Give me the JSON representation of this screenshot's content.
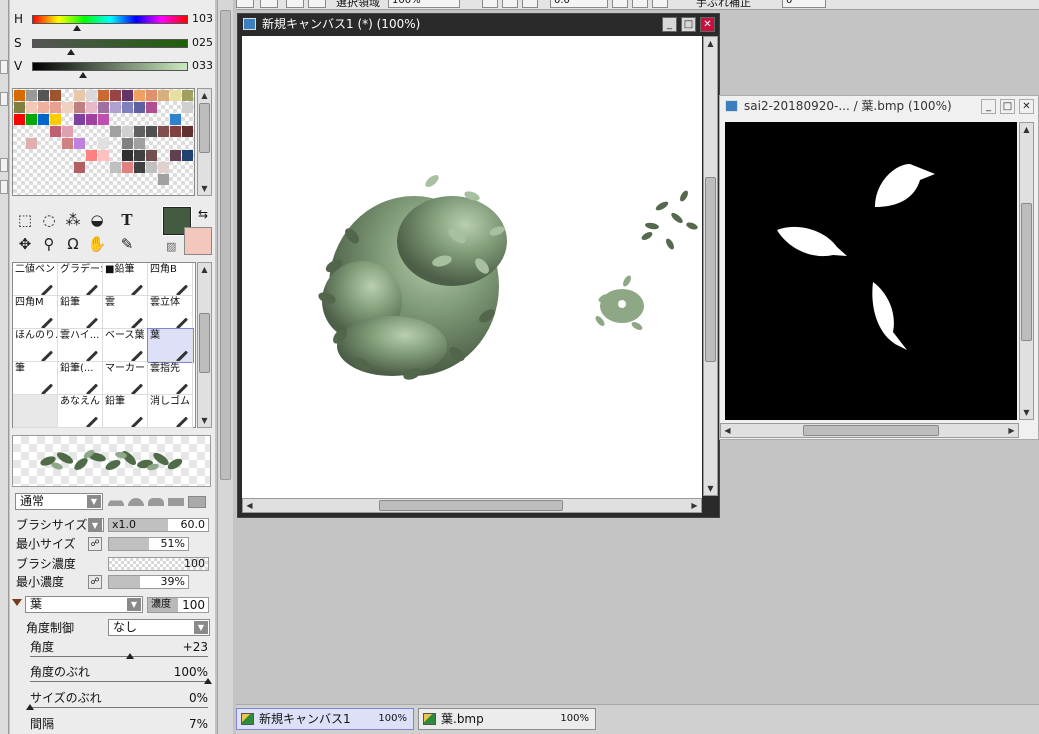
{
  "toolbar": {
    "select_area_label": "選択領域",
    "zoom_value": "100%",
    "angle_value": "0.0",
    "stabilizer_label": "手ぶれ補正",
    "stabilizer_value": "0"
  },
  "color": {
    "h_label": "H",
    "h_value": "103",
    "h_level": 0.29,
    "s_label": "S",
    "s_value": "025",
    "s_level": 0.25,
    "v_label": "V",
    "v_value": "033",
    "v_level": 0.33,
    "foreground": "#435b40",
    "background": "#f4c7bd"
  },
  "swatches": [
    "#d96a00",
    "#999999",
    "#555555",
    "#a0522d",
    "#ffffff",
    "#e8c8a8",
    "#d9d9d9",
    "#cc6633",
    "#994444",
    "#663366",
    "#f0a060",
    "#e0906a",
    "#d8b080",
    "#e8e0a0",
    "#a0a060",
    "#808040",
    "#f4c8b8",
    "#f0b0a0",
    "#e8a090",
    "#f0d0c0",
    "#c08080",
    "#e8b8c8",
    "#a070a0",
    "#b0a0d0",
    "#8080c0",
    "#6060a0",
    "#b05090",
    "#ffffff",
    "#ffffff",
    "#d0d0d0",
    "#ff0000",
    "#00aa00",
    "#0066cc",
    "#ffcc00",
    "#ffffff",
    "#8040a0",
    "#a040a0",
    "#c050b0",
    "#ffffff",
    "#ffffff",
    "#ffffff",
    "#ffffff",
    "#ffffff",
    "#3080d0",
    "#ffffff",
    "#ffffff",
    "#ffffff",
    "#ffffff",
    "#c06070",
    "#e0a0b0",
    "#ffffff",
    "#ffffff",
    "#ffffff",
    "#a0a0a0",
    "#d0d0d0",
    "#606060",
    "#505050",
    "#805050",
    "#804040",
    "#603030",
    "#ffffff",
    "#e0b0b0",
    "#ffffff",
    "#ffffff",
    "#d08080",
    "#c080e0",
    "#ffffff",
    "#e0e0e0",
    "#ffffff",
    "#808080",
    "#a0a0a0",
    "#ffffff",
    "#ffffff",
    "#ffffff",
    "#ffffff",
    "#ffffff",
    "#ffffff",
    "#ffffff",
    "#ffffff",
    "#ffffff",
    "#ffffff",
    "#ff8080",
    "#ffc0c0",
    "#ffffff",
    "#303030",
    "#404040",
    "#705050",
    "#ffffff",
    "#604050",
    "#204070",
    "#ffffff",
    "#ffffff",
    "#ffffff",
    "#ffffff",
    "#ffffff",
    "#b06060",
    "#ffffff",
    "#ffffff",
    "#c0c0c0",
    "#e08080",
    "#404040",
    "#c0c0c0",
    "#e0d0d0",
    "#ffffff",
    "#ffffff",
    "#ffffff",
    "#ffffff",
    "#ffffff",
    "#ffffff",
    "#ffffff",
    "#ffffff",
    "#ffffff",
    "#ffffff",
    "#ffffff",
    "#ffffff",
    "#ffffff",
    "#ffffff",
    "#a0a0a0",
    "#ffffff",
    "#ffffff",
    "#ffffff",
    "#ffffff",
    "#ffffff",
    "#ffffff",
    "#ffffff",
    "#ffffff",
    "#ffffff",
    "#ffffff"
  ],
  "brushes": [
    {
      "label": "二値ペン",
      "selected": false
    },
    {
      "label": "グラデーション",
      "selected": false
    },
    {
      "label": "■鉛筆",
      "selected": false
    },
    {
      "label": "四角B",
      "selected": false
    },
    {
      "label": "四角M",
      "selected": false
    },
    {
      "label": "鉛筆",
      "selected": false
    },
    {
      "label": "雲",
      "selected": false
    },
    {
      "label": "雲立体",
      "selected": false
    },
    {
      "label": "ほんのり...",
      "selected": false
    },
    {
      "label": "雲ハイ...",
      "selected": false
    },
    {
      "label": "ベース葉",
      "selected": false
    },
    {
      "label": "葉",
      "selected": true
    },
    {
      "label": "筆",
      "selected": false
    },
    {
      "label": "鉛筆(...",
      "selected": false
    },
    {
      "label": "マーカー",
      "selected": false
    },
    {
      "label": "雲指先",
      "selected": false
    },
    {
      "label": "",
      "selected": false
    },
    {
      "label": "あなえん",
      "selected": false
    },
    {
      "label": "鉛筆",
      "selected": false
    },
    {
      "label": "消しゴム",
      "selected": false
    }
  ],
  "props": {
    "blend_mode": "通常",
    "brush_size_label": "ブラシサイズ",
    "brush_size_mult": "x1.0",
    "brush_size_value": "60.0",
    "min_size_label": "最小サイズ",
    "min_size_value": "51%",
    "min_size_level": 0.51,
    "density_label": "ブラシ濃度",
    "density_value": "100",
    "min_density_label": "最小濃度",
    "min_density_value": "39%",
    "min_density_level": 0.39,
    "texture_select": "葉",
    "texture_density_label": "濃度",
    "texture_density_value": "100",
    "angle_control_label": "角度制御",
    "angle_control_value": "なし",
    "angle_label": "角度",
    "angle_value": "+23",
    "angle_level": 0.56,
    "angle_jitter_label": "角度のぶれ",
    "angle_jitter_value": "100%",
    "angle_jitter_level": 1.0,
    "size_jitter_label": "サイズのぶれ",
    "size_jitter_value": "0%",
    "size_jitter_level": 0.0,
    "interval_label": "間隔",
    "interval_value": "7%"
  },
  "windows": {
    "main_title": "新規キャンバス1 (*) (100%)",
    "sub_title": "sai2-20180920-... / 葉.bmp (100%)"
  },
  "tabs": [
    {
      "label": "新規キャンバス1",
      "zoom": "100%",
      "active": true
    },
    {
      "label": "葉.bmp",
      "zoom": "100%",
      "active": false
    }
  ]
}
